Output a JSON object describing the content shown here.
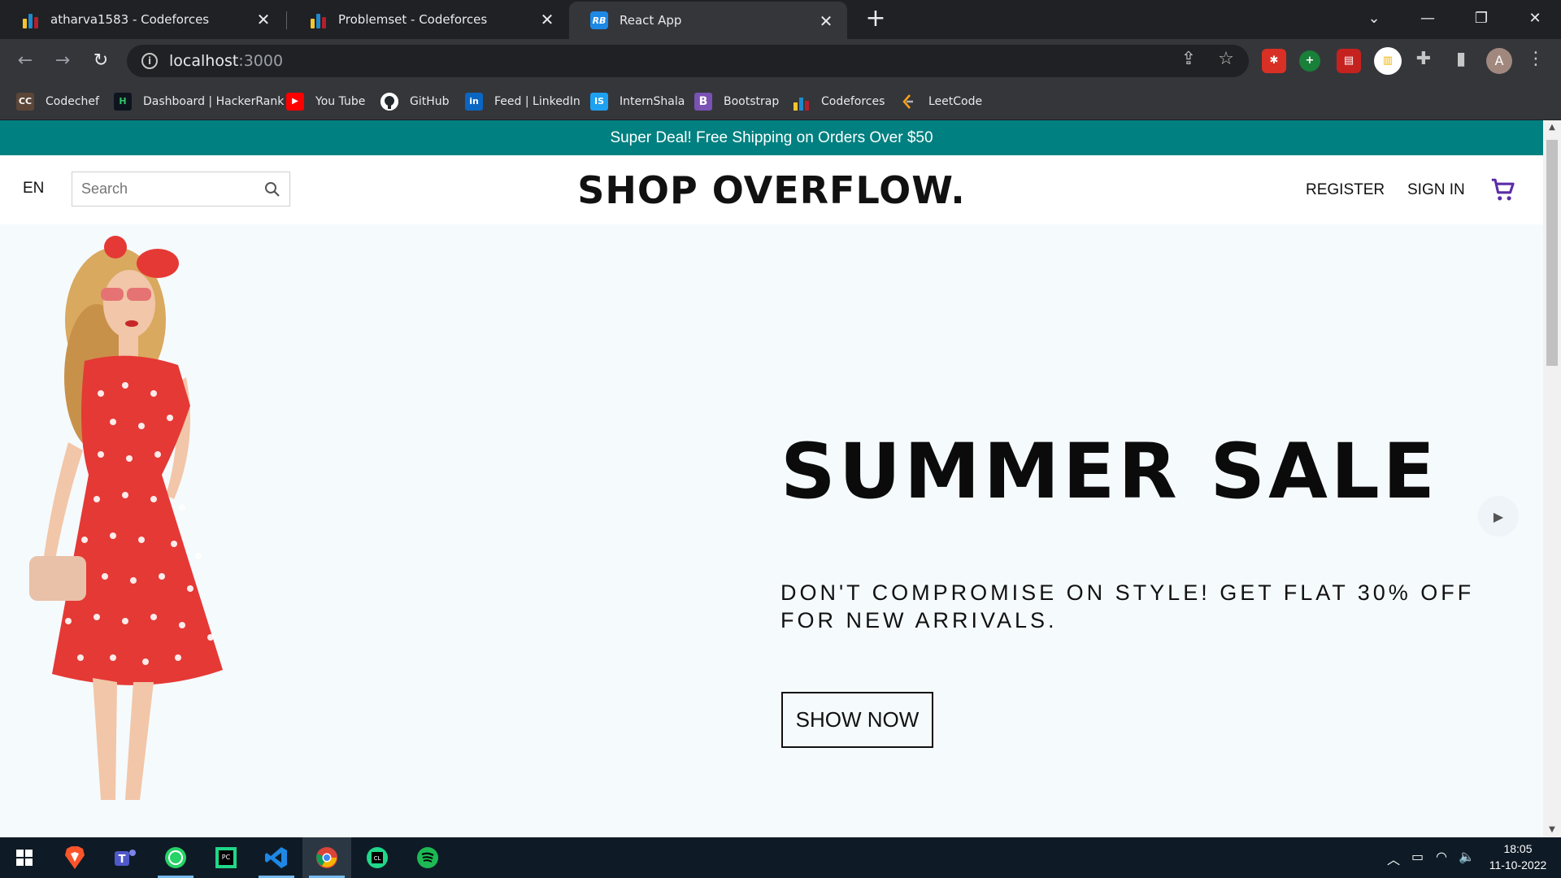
{
  "browser": {
    "tabs": [
      {
        "title": "atharva1583 - Codeforces"
      },
      {
        "title": "Problemset - Codeforces"
      },
      {
        "title": "React App"
      }
    ],
    "address": {
      "host": "localhost",
      "port": ":3000"
    },
    "bookmarks": [
      {
        "label": "Codechef",
        "icon": "codechef-icon",
        "glyph": "CC"
      },
      {
        "label": "Dashboard | HackerRank",
        "icon": "hackerrank-icon",
        "glyph": "H"
      },
      {
        "label": "You Tube",
        "icon": "youtube-icon",
        "glyph": "▶"
      },
      {
        "label": "GitHub",
        "icon": "github-icon",
        "glyph": ""
      },
      {
        "label": "Feed | LinkedIn",
        "icon": "linkedin-icon",
        "glyph": "in"
      },
      {
        "label": "InternShala",
        "icon": "internshala-icon",
        "glyph": "IS"
      },
      {
        "label": "Bootstrap",
        "icon": "bootstrap-icon",
        "glyph": "B"
      },
      {
        "label": "Codeforces",
        "icon": "codeforces-icon",
        "glyph": ""
      },
      {
        "label": "LeetCode",
        "icon": "leetcode-icon",
        "glyph": ""
      }
    ],
    "profile_initial": "A"
  },
  "page": {
    "announcement": "Super Deal! Free Shipping on Orders Over $50",
    "nav": {
      "language": "EN",
      "search_placeholder": "Search",
      "logo": "SHOP OVERFLOW.",
      "register": "REGISTER",
      "sign_in": "SIGN IN"
    },
    "hero": {
      "title": "SUMMER SALE",
      "description": "DON'T COMPROMISE ON STYLE! GET FLAT 30% OFF FOR NEW ARRIVALS.",
      "button": "SHOW NOW"
    }
  },
  "taskbar": {
    "time": "18:05",
    "date": "11-10-2022"
  },
  "colors": {
    "announcement_bg": "#008080",
    "hero_bg": "#f5fafd",
    "cart": "#5b2ea6",
    "browser_dark": "#202124",
    "browser_toolbar": "#35363a"
  }
}
